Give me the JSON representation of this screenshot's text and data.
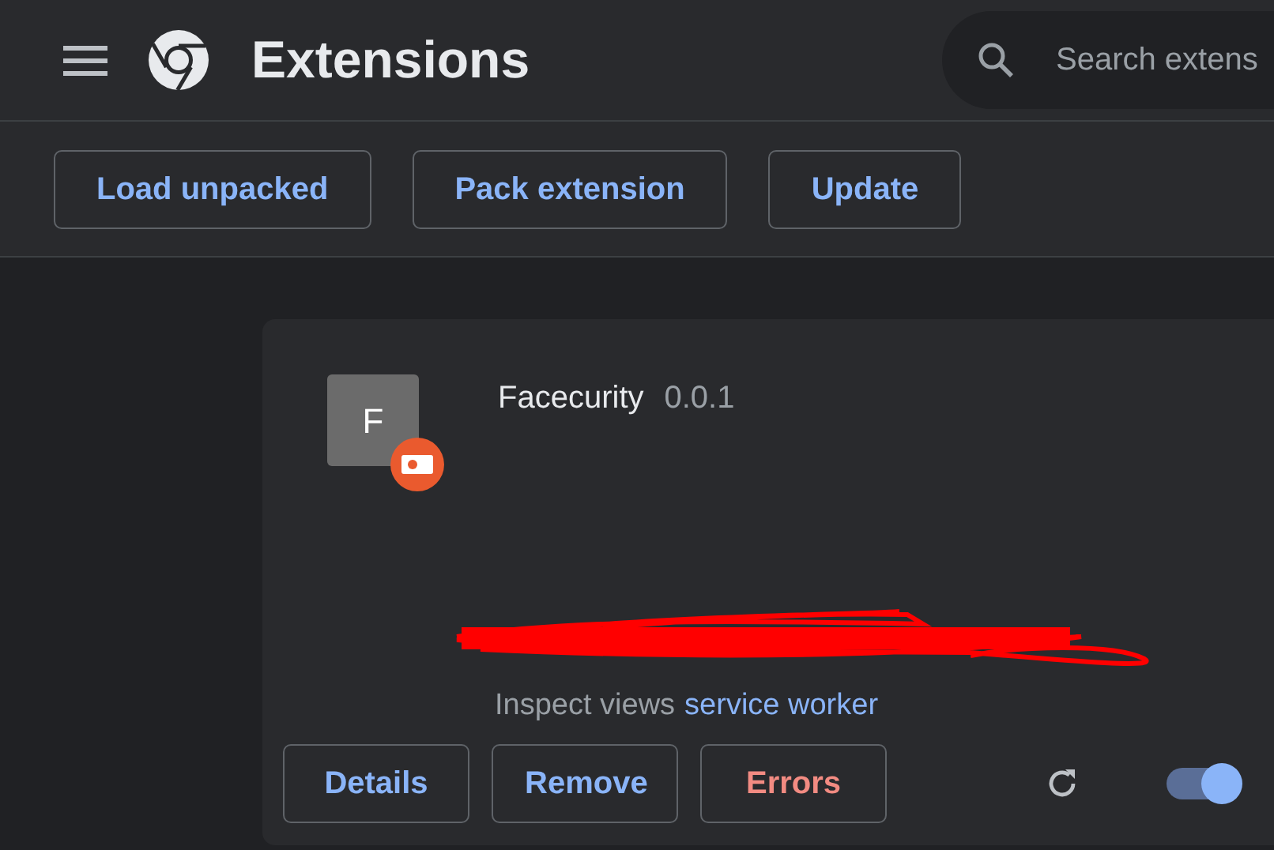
{
  "header": {
    "title": "Extensions",
    "search": {
      "placeholder": "Search extens"
    }
  },
  "toolbar": {
    "buttons": [
      "Load unpacked",
      "Pack extension",
      "Update"
    ]
  },
  "extension": {
    "icon_letter": "F",
    "name": "Facecurity",
    "version": "0.0.1",
    "inspect_label": "Inspect views",
    "inspect_link": "service worker",
    "buttons": [
      {
        "label": "Details",
        "kind": "normal"
      },
      {
        "label": "Remove",
        "kind": "normal"
      },
      {
        "label": "Errors",
        "kind": "error"
      }
    ],
    "enabled": true
  }
}
